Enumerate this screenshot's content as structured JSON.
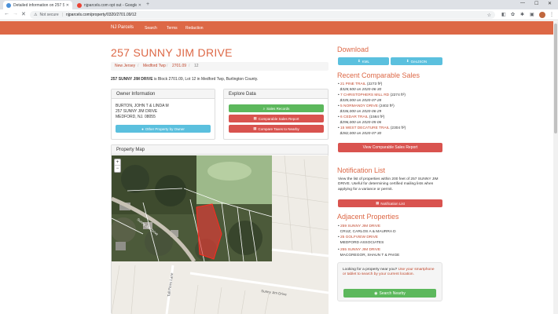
{
  "browser": {
    "tabs": [
      {
        "title": "Detailed information on 257 SU...",
        "active": true
      },
      {
        "title": "njparcels.com opt out - Google ...",
        "active": false
      }
    ],
    "address": {
      "security": "Not secure",
      "separator": "|",
      "url": "njparcels.com/property/0320/2701.09/12"
    }
  },
  "site": {
    "brand": "NJ Parcels",
    "nav": [
      "Search",
      "Terms",
      "Redaction"
    ]
  },
  "property": {
    "title": "257 SUNNY JIM DRIVE",
    "breadcrumb": [
      "New Jersey",
      "Medford Twp",
      "2701.09",
      "12"
    ],
    "summary_bold": "257 SUNNY JIM DRIVE",
    "summary_rest": " is Block 2701.09, Lot 12 in Medford Twp, Burlington County."
  },
  "owner": {
    "heading": "Owner Information",
    "name": "BURTON, JOHN T & LINDA M",
    "street": "257 SUNNY JIM DRIVE",
    "city": "MEDFORD, NJ. 08055",
    "button": "Other Property by Owner"
  },
  "explore": {
    "heading": "Explore Data",
    "buttons": [
      "Sales Records",
      "Comparable Sales Report",
      "Compare Taxes to Nearby"
    ]
  },
  "map": {
    "heading": "Property Map",
    "zoom_in": "+",
    "zoom_out": "−",
    "street_labels": [
      "Sunny Jim Drive",
      "Sunny Jim Drive",
      "Tall Pines Lane"
    ]
  },
  "download": {
    "heading": "Download",
    "buttons": [
      "KML",
      "GeoJSON"
    ]
  },
  "comparables": {
    "heading": "Recent Comparable Sales",
    "items": [
      {
        "address": "21 PINE TRAIL",
        "area": "(2273 ft²)",
        "sale": "$328,500 on 2020-06-30"
      },
      {
        "address": "7 CHRISTOPHERS MILL RD",
        "area": "(2274 ft²)",
        "sale": "$335,000 on 2020-07-28"
      },
      {
        "address": "5 NORMANDY DRIVE",
        "area": "(2402 ft²)",
        "sale": "$336,000 on 2020-06-29"
      },
      {
        "address": "6 CEDAR TRAIL",
        "area": "(1564 ft²)",
        "sale": "$296,000 on 2020-05-06"
      },
      {
        "address": "15 WEST DECATURE TRAIL",
        "area": "(2304 ft²)",
        "sale": "$282,000 on 2020-07-30"
      }
    ],
    "button": "View Comparable Sales Report"
  },
  "notification": {
    "heading": "Notification List",
    "text": "View the list of properties within 200 feet of 257 SUNNY JIM DRIVE. Useful for determining certified mailing lists when applying for a variance or permit.",
    "button": "Notification List"
  },
  "adjacent": {
    "heading": "Adjacent Properties",
    "items": [
      {
        "address": "259 SUNNY JIM DRIVE",
        "owner": "CRUZ, CARLOS A & MAURRA D"
      },
      {
        "address": "25 GOLFVIEW DRIVE",
        "owner": "MEDFORD ASSOCIATES"
      },
      {
        "address": "255 SUNNY JIM DRIVE",
        "owner": "MACGREGOR, SHAUN T & PAIGE"
      }
    ]
  },
  "nearby": {
    "text_before": "Looking for a property near you? ",
    "link": "Use your smartphone or tablet to search by your current location.",
    "button": "Search Nearby"
  },
  "colors": {
    "brand": "#dd6846",
    "info": "#5bc0de",
    "success": "#5cb85c",
    "danger": "#d9534f",
    "parcel": "#e53935"
  },
  "icons": [
    "back-icon",
    "forward-icon",
    "reload-icon",
    "warning-icon",
    "star-icon",
    "menu-icon"
  ]
}
